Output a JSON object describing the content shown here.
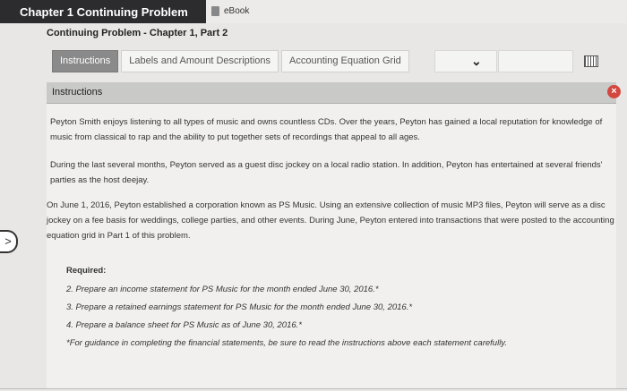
{
  "topbar": {
    "title": "Chapter 1 Continuing Problem",
    "ebook_label": "eBook"
  },
  "subtitle": "Continuing Problem - Chapter 1, Part 2",
  "tabs": [
    {
      "label": "Instructions",
      "active": true
    },
    {
      "label": "Labels and Amount Descriptions",
      "active": false
    },
    {
      "label": "Accounting Equation Grid",
      "active": false
    }
  ],
  "panel": {
    "header_label": "Instructions",
    "close_glyph": "×",
    "paragraphs": [
      "Peyton Smith enjoys listening to all types of music and owns countless CDs. Over the years, Peyton has gained a local reputation for knowledge of music from classical to rap and the ability to put together sets of recordings that appeal to all ages.",
      "During the last several months, Peyton served as a guest disc jockey on a local radio station. In addition, Peyton has entertained at several friends' parties as the host deejay.",
      "On June 1, 2016, Peyton established a corporation known as PS Music. Using an extensive collection of music MP3 files, Peyton will serve as a disc jockey on a fee basis for weddings, college parties, and other events. During June, Peyton entered into transactions that were posted to the accounting equation grid in Part 1 of this problem."
    ],
    "required_label": "Required:",
    "requirements": [
      "2. Prepare an income statement for PS Music for the month ended June 30, 2016.*",
      "3. Prepare a retained earnings statement for PS Music for the month ended June 30, 2016.*",
      "4. Prepare a balance sheet for PS Music as of June 30, 2016.*"
    ],
    "footnote": "*For guidance in completing the financial statements, be sure to read the instructions above each statement carefully."
  },
  "nav": {
    "next_glyph": ">"
  }
}
